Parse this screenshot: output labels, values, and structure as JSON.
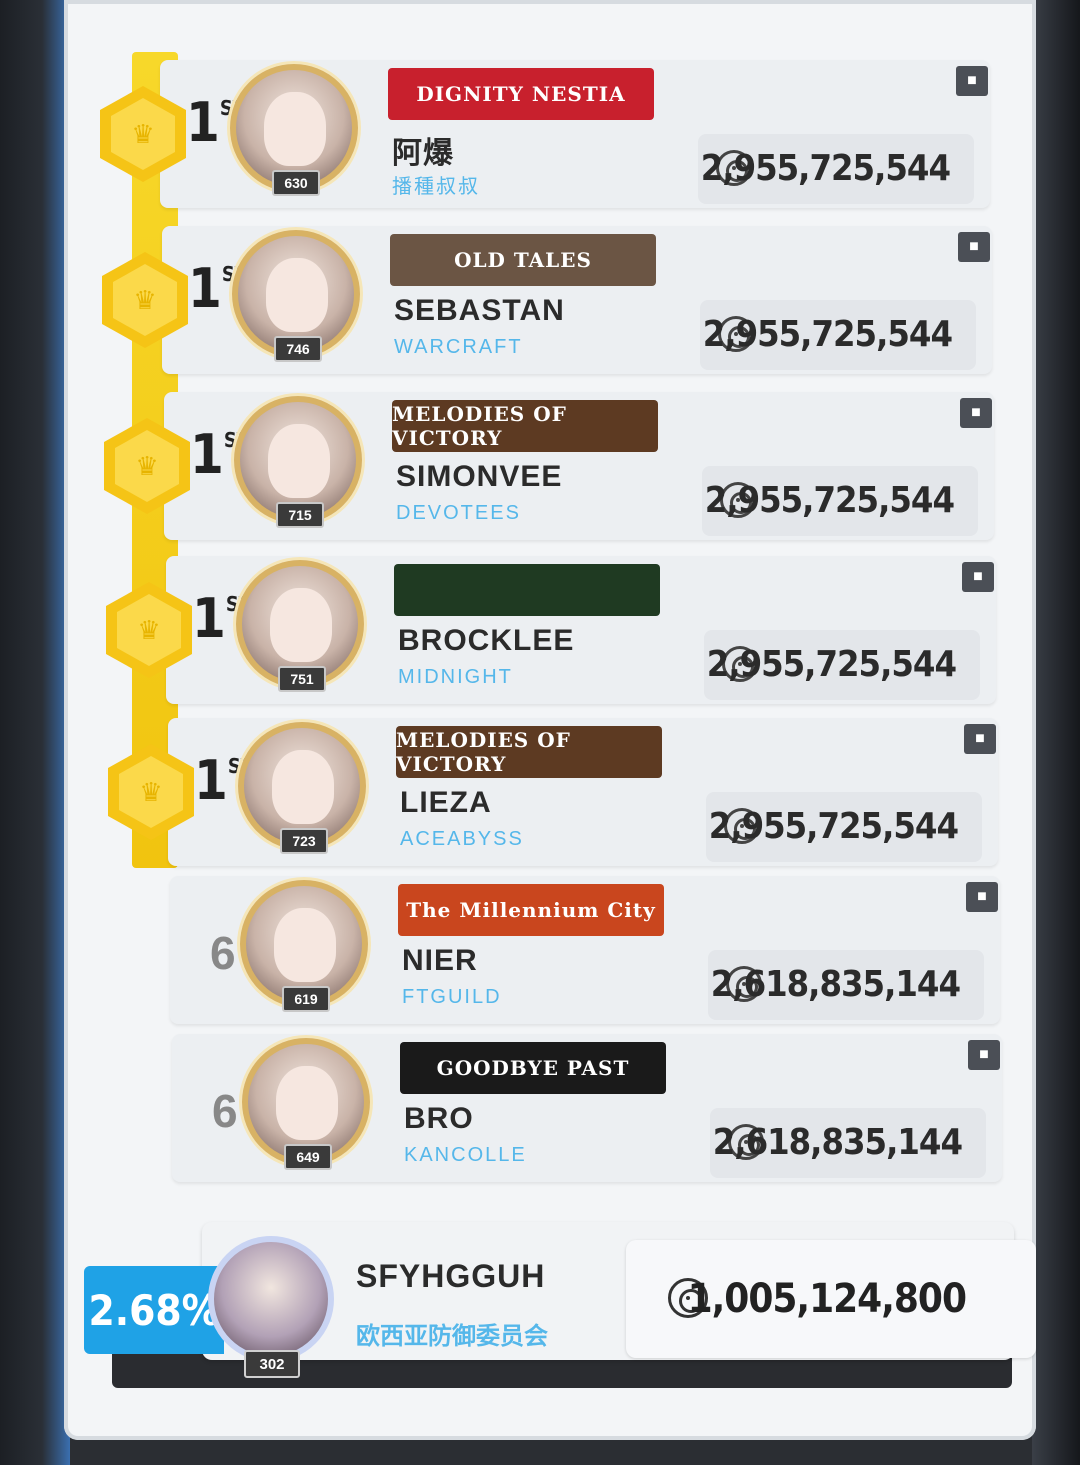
{
  "leaderboard": {
    "rows": [
      {
        "rank": "1",
        "suffix": "ST",
        "level": "630",
        "banner": "DIGNITY  NESTIA",
        "banner_color": "#c8202d",
        "name": "阿爆",
        "guild": "播種叔叔",
        "score": "2,955,725,544",
        "top": true
      },
      {
        "rank": "1",
        "suffix": "ST",
        "level": "746",
        "banner": "OLD TALES",
        "banner_color": "#6b5544",
        "name": "SEBASTAN",
        "guild": "WARCRAFT",
        "score": "2,955,725,544",
        "top": true
      },
      {
        "rank": "1",
        "suffix": "ST",
        "level": "715",
        "banner": "MELODIES OF VICTORY",
        "banner_color": "#5d3a22",
        "name": "SIMONVEE",
        "guild": "DEVOTEES",
        "score": "2,955,725,544",
        "top": true
      },
      {
        "rank": "1",
        "suffix": "ST",
        "level": "751",
        "banner": "",
        "banner_color": "#1f3a22",
        "name": "BROCKLEE",
        "guild": "MIDNIGHT",
        "score": "2,955,725,544",
        "top": true
      },
      {
        "rank": "1",
        "suffix": "ST",
        "level": "723",
        "banner": "MELODIES OF VICTORY",
        "banner_color": "#5d3a22",
        "name": "LIEZA",
        "guild": "ACEABYSS",
        "score": "2,955,725,544",
        "top": true
      },
      {
        "rank": "6",
        "suffix": "",
        "level": "619",
        "banner": "The Millennium City",
        "banner_color": "#c9461e",
        "name": "NIER",
        "guild": "FTGUILD",
        "score": "2,618,835,144",
        "top": false
      },
      {
        "rank": "6",
        "suffix": "",
        "level": "649",
        "banner": "GOODBYE   PAST",
        "banner_color": "#1a1a1a",
        "name": "BRO",
        "guild": "KANCOLLE",
        "score": "2,618,835,144",
        "top": false
      }
    ]
  },
  "me": {
    "percent": "2.68%",
    "level": "302",
    "name": "SFYHGGUH",
    "guild": "欧西亚防御委员会",
    "score": "1,005,124,800"
  },
  "icons": {
    "rank_badge": "crown-hex-icon",
    "score": "target-icon",
    "profile": "profile-icon"
  }
}
